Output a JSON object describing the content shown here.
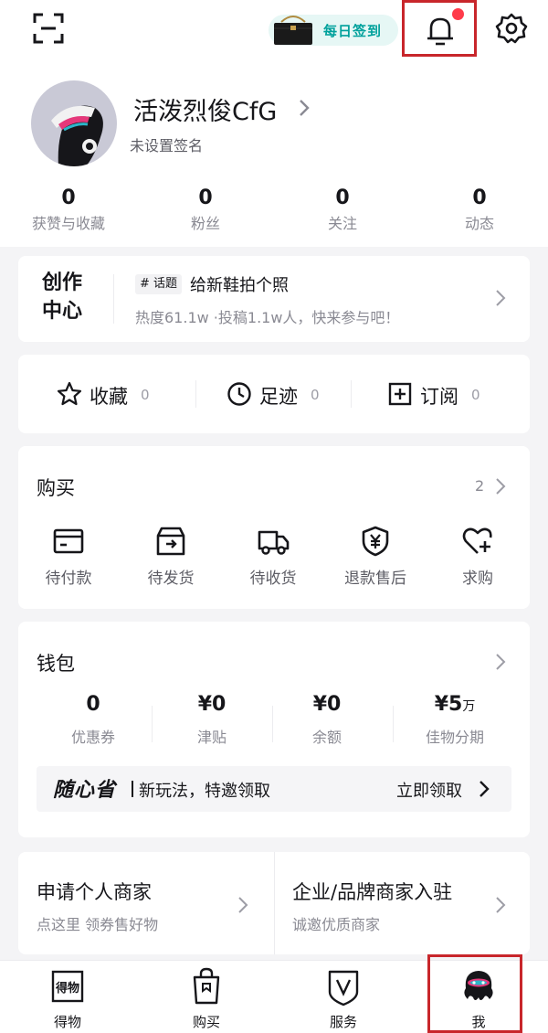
{
  "header": {
    "checkin_label": "每日签到",
    "accent_color": "#00a19c",
    "notification_dot_color": "#ff3b4a"
  },
  "profile": {
    "username": "活泼烈俊CfG",
    "signature": "未设置签名",
    "stats": [
      {
        "value": "0",
        "label": "获赞与收藏"
      },
      {
        "value": "0",
        "label": "粉丝"
      },
      {
        "value": "0",
        "label": "关注"
      },
      {
        "value": "0",
        "label": "动态"
      }
    ]
  },
  "creator": {
    "title_line1": "创作",
    "title_line2": "中心",
    "tag": "# 话题",
    "topic": "给新鞋拍个照",
    "subtitle": "热度61.1w ·投稿1.1w人，快来参与吧！"
  },
  "favorites": [
    {
      "label": "收藏",
      "count": "0",
      "icon": "star-icon"
    },
    {
      "label": "足迹",
      "count": "0",
      "icon": "clock-icon"
    },
    {
      "label": "订阅",
      "count": "0",
      "icon": "plus-square-icon"
    }
  ],
  "purchase": {
    "title": "购买",
    "count": "2",
    "items": [
      {
        "label": "待付款",
        "icon": "card-icon"
      },
      {
        "label": "待发货",
        "icon": "box-icon"
      },
      {
        "label": "待收货",
        "icon": "truck-icon"
      },
      {
        "label": "退款售后",
        "icon": "shield-yen-icon"
      },
      {
        "label": "求购",
        "icon": "heart-plus-icon"
      }
    ]
  },
  "wallet": {
    "title": "钱包",
    "items": [
      {
        "value": "0",
        "label": "优惠券"
      },
      {
        "value": "¥0",
        "label": "津贴"
      },
      {
        "value": "¥0",
        "label": "余额"
      },
      {
        "value": "¥5",
        "unit": "万",
        "label": "佳物分期"
      }
    ],
    "promo_brand": "随心省",
    "promo_text": "新玩法，特邀领取",
    "promo_cta": "立即领取"
  },
  "merchant": [
    {
      "title": "申请个人商家",
      "subtitle": "点这里 领券售好物"
    },
    {
      "title": "企业/品牌商家入驻",
      "subtitle": "诚邀优质商家"
    }
  ],
  "tabs": [
    {
      "label": "得物"
    },
    {
      "label": "购买"
    },
    {
      "label": "服务"
    },
    {
      "label": "我"
    }
  ],
  "highlight_color": "#c8262b"
}
